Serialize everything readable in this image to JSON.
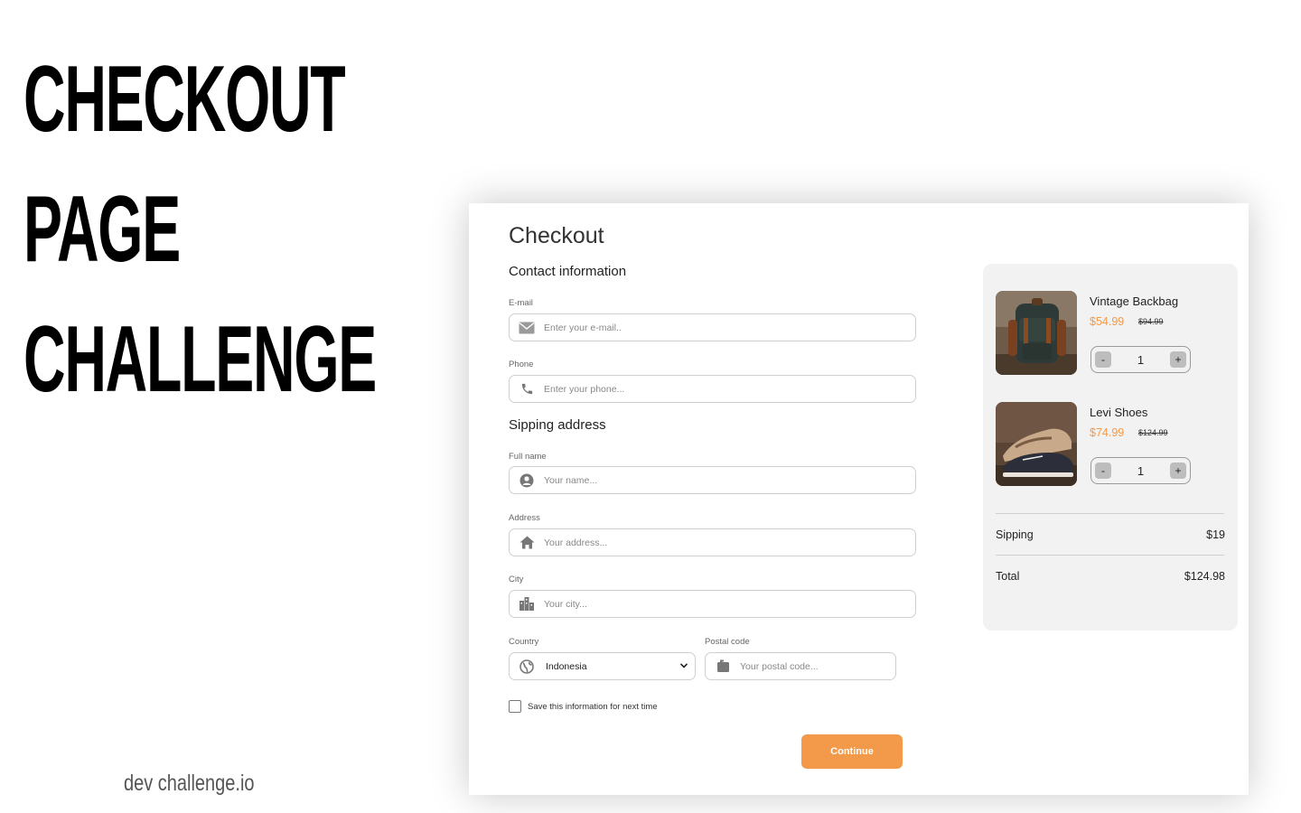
{
  "poster": {
    "line1": "CHECKOUT",
    "line2": "PAGE",
    "line3": "CHALLENGE",
    "credit": "dev challenge.io"
  },
  "checkout": {
    "title": "Checkout",
    "contact_title": "Contact information",
    "email": {
      "label": "E-mail",
      "placeholder": "Enter your e-mail..",
      "icon": "envelope-icon"
    },
    "phone": {
      "label": "Phone",
      "placeholder": "Enter your phone...",
      "icon": "phone-icon"
    },
    "shipping_title": "Sipping address",
    "fullname": {
      "label": "Full name",
      "placeholder": "Your name...",
      "icon": "user-icon"
    },
    "address": {
      "label": "Address",
      "placeholder": "Your address...",
      "icon": "home-icon"
    },
    "city": {
      "label": "City",
      "placeholder": "Your city...",
      "icon": "city-icon"
    },
    "country": {
      "label": "Country",
      "value": "Indonesia",
      "icon": "globe-icon"
    },
    "postal": {
      "label": "Postal code",
      "placeholder": "Your postal code...",
      "icon": "mailbox-icon"
    },
    "save_label": "Save this information for next time",
    "continue_label": "Continue"
  },
  "summary": {
    "items": [
      {
        "name": "Vintage Backbag",
        "price": "$54.99",
        "old_price": "$94.99",
        "qty": "1",
        "minus": "-",
        "plus": "+"
      },
      {
        "name": "Levi Shoes",
        "price": "$74.99",
        "old_price": "$124.99",
        "qty": "1",
        "minus": "-",
        "plus": "+"
      }
    ],
    "shipping_label": "Sipping",
    "shipping_value": "$19",
    "total_label": "Total",
    "total_value": "$124.98"
  },
  "colors": {
    "accent": "#f2994a",
    "panel": "#f2f2f2",
    "border": "#cfcfcf"
  }
}
